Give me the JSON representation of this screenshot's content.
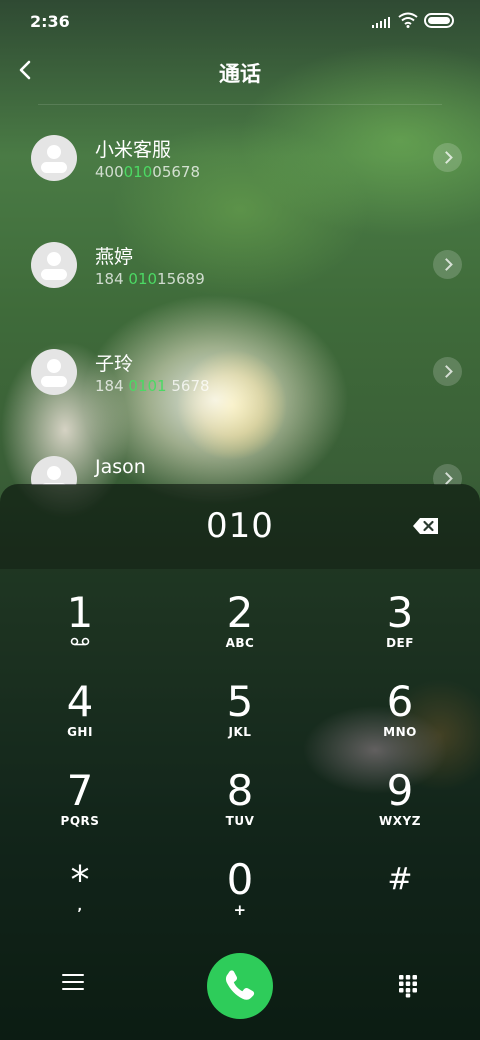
{
  "status_bar": {
    "time": "2:36"
  },
  "header": {
    "title": "通话"
  },
  "contacts": [
    {
      "name": "小米客服",
      "number_pre": "400",
      "number_hl": "010",
      "number_post": "05678"
    },
    {
      "name": "燕婷",
      "number_pre": "184 ",
      "number_hl": "010",
      "number_post": "15689"
    },
    {
      "name": "子玲",
      "number_pre": "184 ",
      "number_hl": "0101",
      "number_post": " 5678"
    },
    {
      "name": "Jason",
      "number_pre": "",
      "number_hl": "",
      "number_post": ""
    }
  ],
  "dialer": {
    "entered_number": "010",
    "keys": [
      {
        "digit": "1",
        "letters": ""
      },
      {
        "digit": "2",
        "letters": "ABC"
      },
      {
        "digit": "3",
        "letters": "DEF"
      },
      {
        "digit": "4",
        "letters": "GHI"
      },
      {
        "digit": "5",
        "letters": "JKL"
      },
      {
        "digit": "6",
        "letters": "MNO"
      },
      {
        "digit": "7",
        "letters": "PQRS"
      },
      {
        "digit": "8",
        "letters": "TUV"
      },
      {
        "digit": "9",
        "letters": "WXYZ"
      },
      {
        "digit": "*",
        "letters": ","
      },
      {
        "digit": "0",
        "letters": "+"
      },
      {
        "digit": "#",
        "letters": ""
      }
    ]
  },
  "icons": {
    "back": "back-icon",
    "voicemail": "voicemail-icon",
    "backspace": "backspace-icon",
    "menu": "menu-icon",
    "call": "phone-icon",
    "keypad": "keypad-icon"
  },
  "colors": {
    "highlight": "#4cd964",
    "call_button": "#2ecc5a"
  }
}
